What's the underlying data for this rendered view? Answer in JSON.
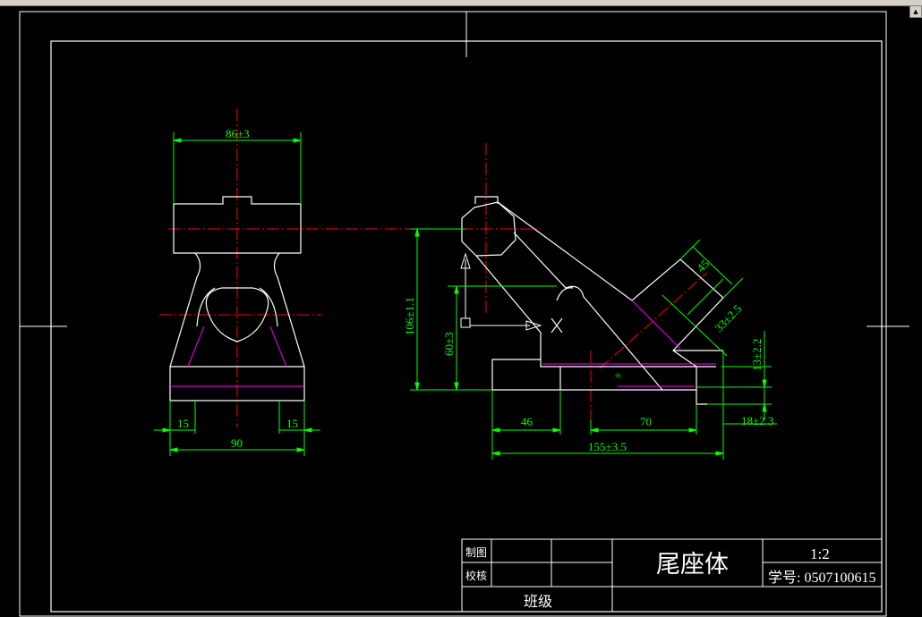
{
  "drawing": {
    "front_view": {
      "dim_width_top": "86±3",
      "dim_left": "15",
      "dim_right": "15",
      "dim_width_bottom": "90"
    },
    "side_view": {
      "dim_height_total": "106±1.1",
      "dim_height_hole": "60±3",
      "dim_45": "45",
      "dim_33": "33±2.5",
      "dim_13": "13±2.2",
      "dim_46": "46",
      "dim_70": "70",
      "dim_18": "18±2.3",
      "dim_155": "155±3.5",
      "dim_small": "9"
    }
  },
  "title_block": {
    "drawn_label": "制图",
    "checked_label": "校核",
    "class_label": "班级",
    "part_name": "尾座体",
    "scale": "1:2",
    "student_no": "学号: 0507100615"
  },
  "colors": {
    "outline": "#ffffff",
    "centerline": "#ff0000",
    "dimension": "#00ff00",
    "hidden": "#ff00ff"
  }
}
